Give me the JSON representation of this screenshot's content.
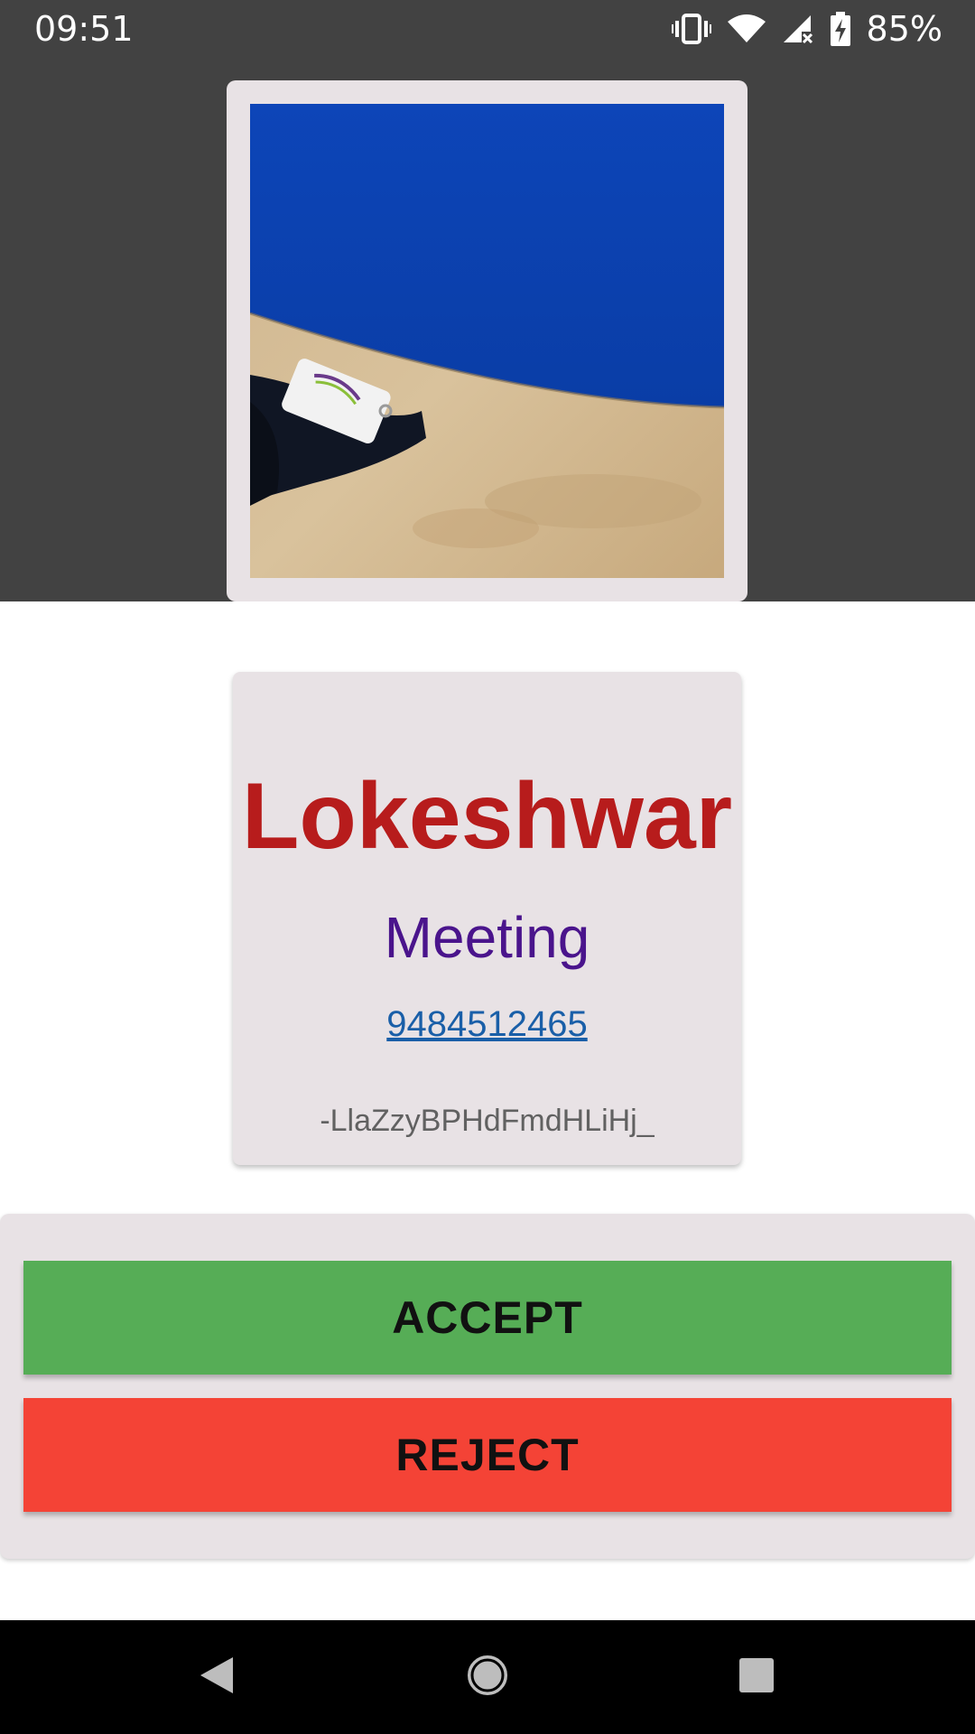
{
  "status_bar": {
    "time": "09:51",
    "battery_percent": "85%",
    "icons": [
      "vibrate-icon",
      "wifi-icon",
      "cell-signal-icon",
      "battery-charging-icon"
    ]
  },
  "visitor": {
    "name": "Lokeshwar",
    "purpose": "Meeting",
    "phone": "9484512465",
    "id": "-LlaZzyBPHdFmdHLiHj_"
  },
  "actions": {
    "accept_label": "ACCEPT",
    "reject_label": "REJECT"
  },
  "nav": {
    "icons": [
      "back-icon",
      "home-icon",
      "recents-icon"
    ]
  },
  "colors": {
    "header_bg": "#424242",
    "card_bg": "#e8e2e5",
    "name_color": "#b71c1c",
    "purpose_color": "#4a148c",
    "phone_color": "#1a5fa8",
    "accept_bg": "#56ad56",
    "reject_bg": "#f44336"
  }
}
